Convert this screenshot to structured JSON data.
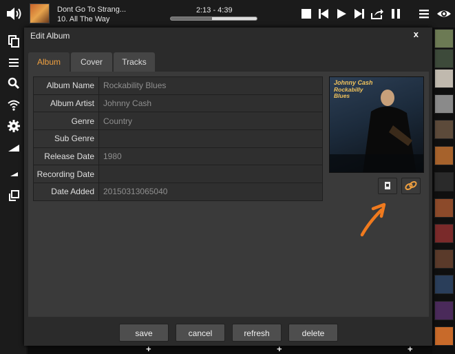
{
  "player": {
    "now_playing_title": "Dont Go To Strang...",
    "now_playing_track": "10. All The Way",
    "time_display": "2:13 - 4:39",
    "progress_fraction": 0.477
  },
  "modal": {
    "title": "Edit Album",
    "close_label": "x",
    "tabs": [
      {
        "label": "Album",
        "active": true
      },
      {
        "label": "Cover",
        "active": false
      },
      {
        "label": "Tracks",
        "active": false
      }
    ],
    "fields": [
      {
        "label": "Album Name",
        "value": "Rockability Blues"
      },
      {
        "label": "Album Artist",
        "value": "Johnny Cash"
      },
      {
        "label": "Genre",
        "value": "Country"
      },
      {
        "label": "Sub Genre",
        "value": ""
      },
      {
        "label": "Release Date",
        "value": "1980"
      },
      {
        "label": "Recording Date",
        "value": ""
      },
      {
        "label": "Date Added",
        "value": "20150313065040"
      }
    ],
    "cover": {
      "artist_text": "Johnny Cash",
      "album_text": "Rockabilly Blues"
    },
    "buttons": {
      "save": "save",
      "cancel": "cancel",
      "refresh": "refresh",
      "delete": "delete"
    }
  },
  "colors": {
    "accent": "#f0a040",
    "arrow": "#f07a1e",
    "background": "#151515",
    "modal": "#2b2b2b"
  },
  "icons": [
    "volume-icon",
    "stop-icon",
    "previous-icon",
    "play-icon",
    "next-icon",
    "share-icon",
    "pause-icon",
    "menu-icon",
    "eye-icon",
    "copy-icon",
    "list-icon",
    "search-icon",
    "wifi-icon",
    "gear-icon",
    "signal-icon",
    "small-signal-icon",
    "window-icon",
    "upload-image-icon",
    "link-icon"
  ]
}
